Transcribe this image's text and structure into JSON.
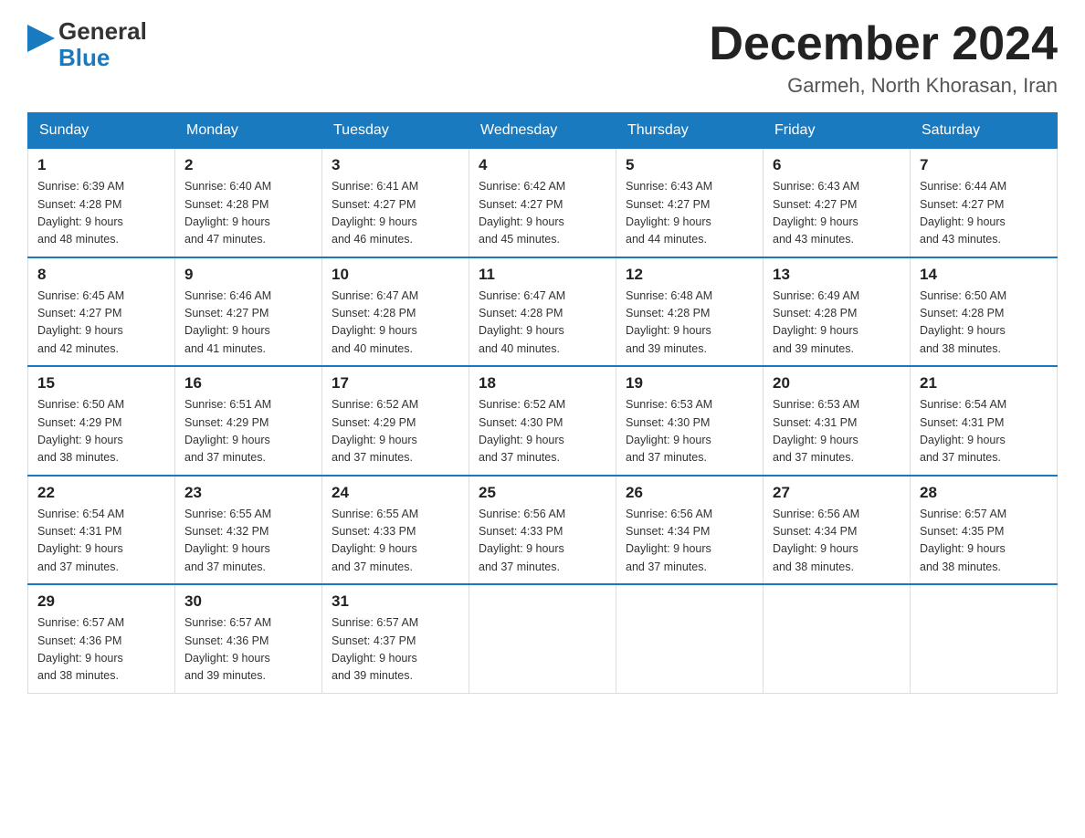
{
  "header": {
    "logo_general": "General",
    "logo_blue": "Blue",
    "month_title": "December 2024",
    "location": "Garmeh, North Khorasan, Iran"
  },
  "weekdays": [
    "Sunday",
    "Monday",
    "Tuesday",
    "Wednesday",
    "Thursday",
    "Friday",
    "Saturday"
  ],
  "weeks": [
    [
      {
        "day": "1",
        "sunrise": "6:39 AM",
        "sunset": "4:28 PM",
        "daylight": "9 hours and 48 minutes."
      },
      {
        "day": "2",
        "sunrise": "6:40 AM",
        "sunset": "4:28 PM",
        "daylight": "9 hours and 47 minutes."
      },
      {
        "day": "3",
        "sunrise": "6:41 AM",
        "sunset": "4:27 PM",
        "daylight": "9 hours and 46 minutes."
      },
      {
        "day": "4",
        "sunrise": "6:42 AM",
        "sunset": "4:27 PM",
        "daylight": "9 hours and 45 minutes."
      },
      {
        "day": "5",
        "sunrise": "6:43 AM",
        "sunset": "4:27 PM",
        "daylight": "9 hours and 44 minutes."
      },
      {
        "day": "6",
        "sunrise": "6:43 AM",
        "sunset": "4:27 PM",
        "daylight": "9 hours and 43 minutes."
      },
      {
        "day": "7",
        "sunrise": "6:44 AM",
        "sunset": "4:27 PM",
        "daylight": "9 hours and 43 minutes."
      }
    ],
    [
      {
        "day": "8",
        "sunrise": "6:45 AM",
        "sunset": "4:27 PM",
        "daylight": "9 hours and 42 minutes."
      },
      {
        "day": "9",
        "sunrise": "6:46 AM",
        "sunset": "4:27 PM",
        "daylight": "9 hours and 41 minutes."
      },
      {
        "day": "10",
        "sunrise": "6:47 AM",
        "sunset": "4:28 PM",
        "daylight": "9 hours and 40 minutes."
      },
      {
        "day": "11",
        "sunrise": "6:47 AM",
        "sunset": "4:28 PM",
        "daylight": "9 hours and 40 minutes."
      },
      {
        "day": "12",
        "sunrise": "6:48 AM",
        "sunset": "4:28 PM",
        "daylight": "9 hours and 39 minutes."
      },
      {
        "day": "13",
        "sunrise": "6:49 AM",
        "sunset": "4:28 PM",
        "daylight": "9 hours and 39 minutes."
      },
      {
        "day": "14",
        "sunrise": "6:50 AM",
        "sunset": "4:28 PM",
        "daylight": "9 hours and 38 minutes."
      }
    ],
    [
      {
        "day": "15",
        "sunrise": "6:50 AM",
        "sunset": "4:29 PM",
        "daylight": "9 hours and 38 minutes."
      },
      {
        "day": "16",
        "sunrise": "6:51 AM",
        "sunset": "4:29 PM",
        "daylight": "9 hours and 37 minutes."
      },
      {
        "day": "17",
        "sunrise": "6:52 AM",
        "sunset": "4:29 PM",
        "daylight": "9 hours and 37 minutes."
      },
      {
        "day": "18",
        "sunrise": "6:52 AM",
        "sunset": "4:30 PM",
        "daylight": "9 hours and 37 minutes."
      },
      {
        "day": "19",
        "sunrise": "6:53 AM",
        "sunset": "4:30 PM",
        "daylight": "9 hours and 37 minutes."
      },
      {
        "day": "20",
        "sunrise": "6:53 AM",
        "sunset": "4:31 PM",
        "daylight": "9 hours and 37 minutes."
      },
      {
        "day": "21",
        "sunrise": "6:54 AM",
        "sunset": "4:31 PM",
        "daylight": "9 hours and 37 minutes."
      }
    ],
    [
      {
        "day": "22",
        "sunrise": "6:54 AM",
        "sunset": "4:31 PM",
        "daylight": "9 hours and 37 minutes."
      },
      {
        "day": "23",
        "sunrise": "6:55 AM",
        "sunset": "4:32 PM",
        "daylight": "9 hours and 37 minutes."
      },
      {
        "day": "24",
        "sunrise": "6:55 AM",
        "sunset": "4:33 PM",
        "daylight": "9 hours and 37 minutes."
      },
      {
        "day": "25",
        "sunrise": "6:56 AM",
        "sunset": "4:33 PM",
        "daylight": "9 hours and 37 minutes."
      },
      {
        "day": "26",
        "sunrise": "6:56 AM",
        "sunset": "4:34 PM",
        "daylight": "9 hours and 37 minutes."
      },
      {
        "day": "27",
        "sunrise": "6:56 AM",
        "sunset": "4:34 PM",
        "daylight": "9 hours and 38 minutes."
      },
      {
        "day": "28",
        "sunrise": "6:57 AM",
        "sunset": "4:35 PM",
        "daylight": "9 hours and 38 minutes."
      }
    ],
    [
      {
        "day": "29",
        "sunrise": "6:57 AM",
        "sunset": "4:36 PM",
        "daylight": "9 hours and 38 minutes."
      },
      {
        "day": "30",
        "sunrise": "6:57 AM",
        "sunset": "4:36 PM",
        "daylight": "9 hours and 39 minutes."
      },
      {
        "day": "31",
        "sunrise": "6:57 AM",
        "sunset": "4:37 PM",
        "daylight": "9 hours and 39 minutes."
      },
      null,
      null,
      null,
      null
    ]
  ],
  "accent_color": "#1a7abf"
}
